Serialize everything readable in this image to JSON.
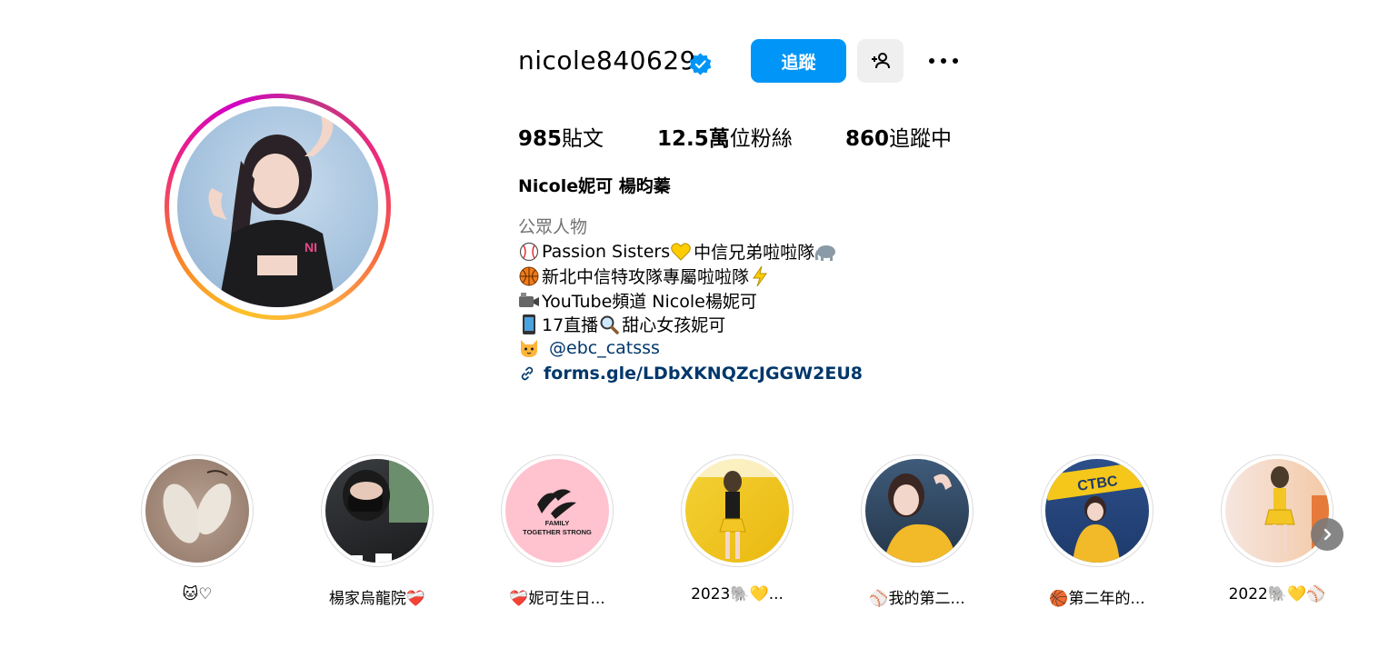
{
  "profile": {
    "username": "nicole840629",
    "follow_label": "追蹤",
    "stats": {
      "posts_count": "985",
      "posts_label": "貼文",
      "followers_count": "12.5萬",
      "followers_label": "位粉絲",
      "following_count": "860",
      "following_label": "追蹤中"
    },
    "full_name": "Nicole妮可 楊昀蓁",
    "category": "公眾人物",
    "bio": {
      "line1": "Passion Sisters",
      "line1b": "中信兄弟啦啦隊",
      "line2": "新北中信特攻隊專屬啦啦隊",
      "line3": "YouTube頻道 Nicole楊妮可",
      "line4a": "17直播",
      "line4b": "甜心女孩妮可",
      "mention": "@ebc_catsss",
      "link": "forms.gle/LDbXKNQZcJGGW2EU8"
    }
  },
  "highlights": [
    {
      "label": "🐱♡"
    },
    {
      "label": "楊家烏龍院❤️‍🩹"
    },
    {
      "label": "❤️‍🩹妮可生日..."
    },
    {
      "label": "2023🐘💛..."
    },
    {
      "label": "⚾我的第二..."
    },
    {
      "label": "🏀第二年的..."
    },
    {
      "label": "2022🐘💛⚾"
    }
  ],
  "highlight_texts": {
    "family_line1": "FAMILY",
    "family_line2": "TOGETHER STRONG"
  },
  "colors": {
    "follow_button": "#0095f6",
    "link": "#00376b",
    "muted_text": "#737373",
    "verified": "#0095f6"
  },
  "icons": [
    "verified-badge-icon",
    "add-person-icon",
    "more-options-icon",
    "link-icon",
    "chevron-right-icon"
  ]
}
